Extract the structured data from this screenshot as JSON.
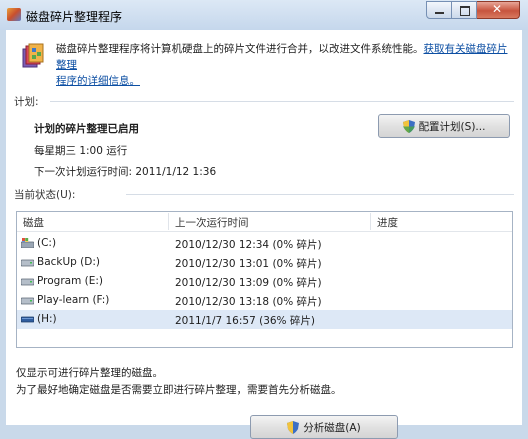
{
  "window": {
    "title": "磁盘碎片整理程序"
  },
  "intro": {
    "text": "磁盘碎片整理程序将计算机硬盘上的碎片文件进行合并，以改进文件系统性能。",
    "link_part1": "获取有关磁盘碎片整理",
    "link_part2": "程序的详细信息。"
  },
  "schedule": {
    "section_label": "计划:",
    "status": "计划的碎片整理已启用",
    "frequency": "每星期三 1:00 运行",
    "next_run": "下一次计划运行时间: 2011/1/12 1:36",
    "configure_button": "配置计划(S)..."
  },
  "current_status": {
    "section_label": "当前状态(U):",
    "columns": [
      "磁盘",
      "上一次运行时间",
      "进度"
    ],
    "rows": [
      {
        "disk": "(C:)",
        "last_run": "2010/12/30 12:34 (0% 碎片)",
        "progress": ""
      },
      {
        "disk": "BackUp (D:)",
        "last_run": "2010/12/30 13:01 (0% 碎片)",
        "progress": ""
      },
      {
        "disk": "Program (E:)",
        "last_run": "2010/12/30 13:09 (0% 碎片)",
        "progress": ""
      },
      {
        "disk": "Play-learn (F:)",
        "last_run": "2010/12/30 13:18 (0% 碎片)",
        "progress": ""
      },
      {
        "disk": "(H:)",
        "last_run": "2011/1/7 16:57 (36% 碎片)",
        "progress": ""
      }
    ]
  },
  "notes": {
    "line1": "仅显示可进行碎片整理的磁盘。",
    "line2": "为了最好地确定磁盘是否需要立即进行碎片整理，需要首先分析磁盘。"
  },
  "footer": {
    "analyze_button": "分析磁盘(A)"
  },
  "colors": {
    "link": "#0d4fa3",
    "selected_row": "#dde8f6"
  }
}
